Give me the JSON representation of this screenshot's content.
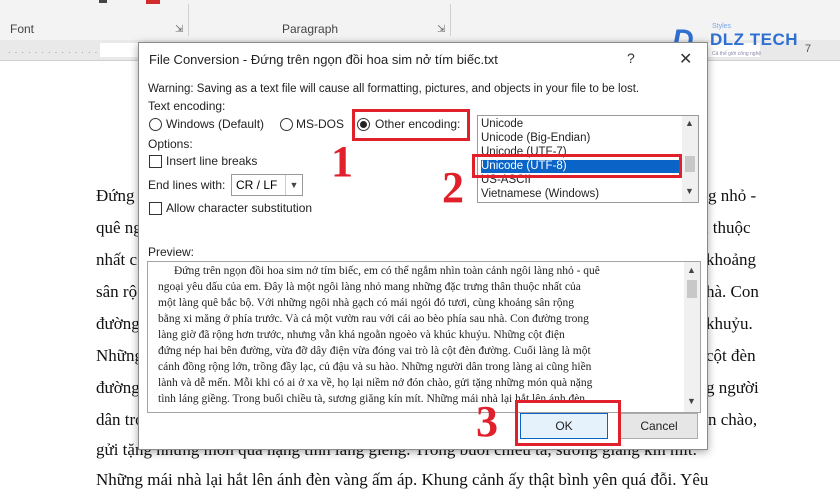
{
  "ribbon": {
    "font_group": "Font",
    "paragraph_group": "Paragraph"
  },
  "ruler": {
    "right_number": "7"
  },
  "logo": {
    "brand": "DLZ TECH",
    "subtitle": "Styles",
    "tagline": "Cả thế giới công nghệ"
  },
  "document": {
    "lines": [
      "Đứng",
      "quê ng",
      "nhất c",
      "sân rộ",
      "đường",
      "Những",
      "đường",
      "dân tro",
      "gửi tặng những món quà nặng tình láng giềng. Trong buổi chiều tà, sương giăng kín mít.",
      "Những mái nhà lại hắt lên ánh đèn vàng ấm áp. Khung cảnh ấy thật bình yên quá đỗi. Yêu"
    ],
    "right_fragments": [
      "g nhỏ -",
      "n thuộc",
      "khoảng",
      "hà. Con",
      "khuỷu.",
      "cột đèn",
      "g người",
      "n chào,"
    ]
  },
  "dialog": {
    "title": "File Conversion - Đứng trên ngọn đồi hoa sim nở tím biếc.txt",
    "help_label": "?",
    "close_label": "✕",
    "warning": "Warning: Saving as a text file will cause all formatting, pictures, and objects in your file to be lost.",
    "text_encoding_label": "Text encoding:",
    "radio_windows": "Windows (Default)",
    "radio_msdos": "MS-DOS",
    "radio_other": "Other encoding:",
    "options_label": "Options:",
    "insert_line_breaks": "Insert line breaks",
    "end_lines_label": "End lines with:",
    "end_lines_value": "CR / LF",
    "allow_substitution": "Allow character substitution",
    "preview_label": "Preview:",
    "encodings": [
      "Unicode",
      "Unicode (Big-Endian)",
      "Unicode (UTF-7)",
      "Unicode (UTF-8)",
      "US-ASCII",
      "Vietnamese (Windows)"
    ],
    "selected_encoding": "Unicode (UTF-8)",
    "preview_lines": [
      "Đứng trên ngọn đồi hoa sim nở tím biếc, em có thể ngắm nhìn toàn cảnh ngôi làng nhỏ - quê",
      "ngoại yêu dấu của em. Đây là một ngôi làng nhỏ mang những đặc trưng thân thuộc nhất của",
      "một làng quê bắc bộ. Với những ngôi nhà gạch có mái ngói đỏ tươi, cùng khoảng sân rộng",
      "bằng xi măng ở phía trước. Và cả một vườn rau với cái ao bèo phía sau nhà. Con đường trong",
      "làng giờ đã rộng hơn trước, nhưng vẫn khá ngoằn ngoèo và khúc khuỷu. Những cột điện",
      "đứng nép hai bên đường, vừa đỡ dây điện vừa đóng vai trò là cột đèn đường. Cuối làng là một",
      "cánh đồng rộng lớn, trồng đầy lạc, củ đậu và su hào. Những người dân trong làng ai cũng hiền",
      "lành và dễ mến. Mỗi khi có ai ở xa về, họ lại niềm nở đón chào, gửi tặng những món quà nặng",
      "tình láng giềng. Trong buổi chiều tà, sương giăng kín mít. Những mái nhà lại hắt lên ánh đèn"
    ],
    "ok_label": "OK",
    "cancel_label": "Cancel"
  },
  "annotations": {
    "step1": "1",
    "step2": "2",
    "step3": "3"
  },
  "colors": {
    "annotation_red": "#e0202a",
    "selection_blue": "#0a64c8",
    "logo_blue": "#2f6fd1"
  }
}
